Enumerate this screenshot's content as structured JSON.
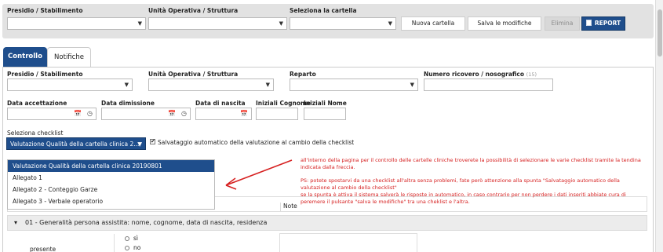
{
  "toolbar": {
    "presidio_label": "Presidio / Stabilimento",
    "unita_label": "Unità Operativa / Struttura",
    "cartella_label": "Seleziona la cartella",
    "nuova_cartella": "Nuova cartella",
    "salva_modifiche": "Salva le modifiche",
    "elimina": "Elimina",
    "report": "REPORT"
  },
  "tabs": [
    "Controllo",
    "Notifiche"
  ],
  "form": {
    "presidio_label": "Presidio / Stabilimento",
    "unita_label": "Unità Operativa / Struttura",
    "reparto_label": "Reparto",
    "ricovero_label": "Numero ricovero / nosografico",
    "ricovero_hint": "(15)",
    "accettazione_label": "Data accettazione",
    "dimissione_label": "Data dimissione",
    "nascita_label": "Data di nascita",
    "iniziali_cognome_label": "Iniziali Cognome",
    "iniziali_nome_label": "Iniziali Nome"
  },
  "checklist": {
    "label": "Seleziona checklist",
    "selected": "Valutazione Qualità della cartella clinica 2...",
    "autosave_label": "Salvataggio automatico della valutazione al cambio della checklist",
    "options": [
      "Valutazione Qualità della cartella clinica 20190801",
      "Allegato 1",
      "Allegato 2 - Conteggio Garze",
      "Allegato 3 - Verbale operatorio"
    ]
  },
  "annotation": {
    "lines": [
      "all'interno della pagina per il controllo delle cartelle cliniche troverete la possibilità di selezionare le varie checklist tramite la tendina",
      "indicata dalla freccia.",
      "",
      "PS: potete spostarvi da una checklist all'altra senza problemi, fate però attenzione alla spunta \"Salvataggio automatico della",
      "valutazione al cambio della checklist\"",
      "se la spunta è attiva il sistema salverà le risposte in automatico, in caso contrario per non perdere i dati inseriti abbiate cura di",
      "peremere il pulsante \"salva le modifiche\" tra una cheklist e l'altra."
    ],
    "color": "#d62020"
  },
  "table": {
    "note_header": "Note",
    "group_title": "01 - Generalità persona assistita: nome, cognome, data di nascita, residenza",
    "row_label": "presente",
    "options": [
      "sì",
      "no"
    ]
  },
  "colors": {
    "primary": "#1f4e8c",
    "toolbar_bg": "#e2e2e2",
    "annotation": "#d62020"
  }
}
